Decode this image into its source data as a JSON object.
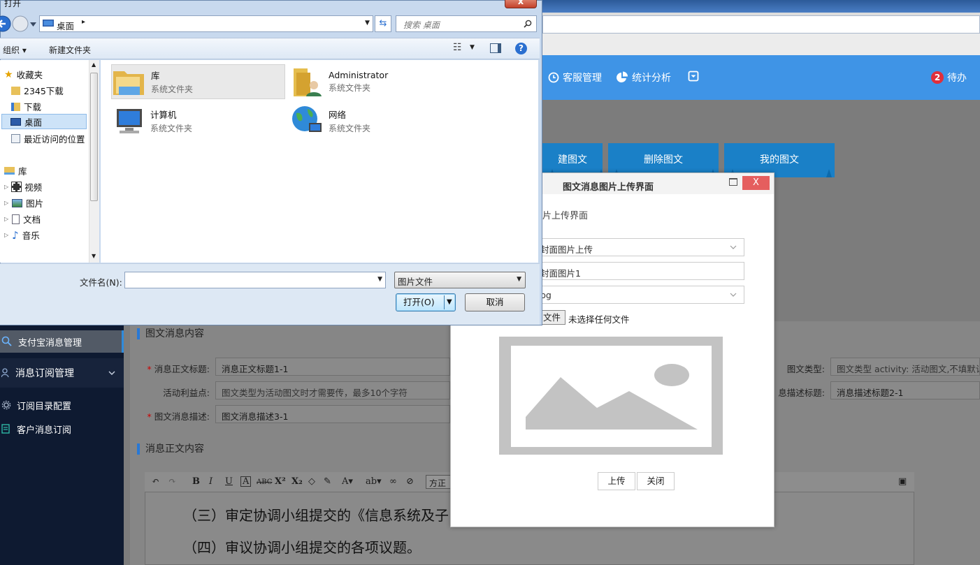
{
  "web": {
    "nav": {
      "service": "客服管理",
      "stats": "统计分析",
      "todo_count": "2",
      "todo_label": "待办"
    },
    "tabs": {
      "create": "建图文",
      "delete": "删除图文",
      "mine": "我的图文"
    },
    "sidebar": {
      "alipay": "支付宝消息管理",
      "subscription": "消息订阅管理",
      "catalog": "订阅目录配置",
      "customer": "客户消息订阅"
    },
    "sections": {
      "content": "图文消息内容",
      "body": "消息正文内容"
    },
    "form": {
      "body_title_label": "消息正文标题:",
      "body_title_value": "消息正文标题1-1",
      "benefit_label": "活动利益点:",
      "benefit_placeholder": "图文类型为活动图文时才需要传，最多10个字符",
      "desc_label": "图文消息描述:",
      "desc_value": "图文消息描述3-1",
      "type_label": "图文类型:",
      "type_placeholder": "图文类型 activity: 活动图文,不填默认普",
      "msg_desc_title_label": "息描述标题:",
      "msg_desc_title_value": "消息描述标题2-1"
    },
    "editor": {
      "font_value": "方正",
      "lines": [
        "（三）审定协调小组提交的《信息系统及子",
        "（四）审议协调小组提交的各项议题。"
      ]
    }
  },
  "modal": {
    "title": "图文消息图片上传界面",
    "subtitle": "片上传界面",
    "upload_type": "封面图片上传",
    "image_name": "封面图片1",
    "format": "pg",
    "choose_file_tail": "文件",
    "no_file": "未选择任何文件",
    "upload_btn": "上传",
    "close_btn": "关闭",
    "close_x": "X"
  },
  "dialog": {
    "title": "打开",
    "close": "x",
    "address": "桌面",
    "search_placeholder": "搜索 桌面",
    "organize": "组织",
    "new_folder": "新建文件夹",
    "nav": {
      "favorites": "收藏夹",
      "downloads2345": "2345下载",
      "downloads": "下载",
      "desktop": "桌面",
      "recent": "最近访问的位置",
      "libraries": "库",
      "videos": "视频",
      "pictures": "图片",
      "documents": "文档",
      "music": "音乐"
    },
    "files": [
      {
        "name": "库",
        "type": "系统文件夹"
      },
      {
        "name": "Administrator",
        "type": "系统文件夹"
      },
      {
        "name": "计算机",
        "type": "系统文件夹"
      },
      {
        "name": "网络",
        "type": "系统文件夹"
      }
    ],
    "filename_label": "文件名(N):",
    "filename_value": "",
    "filetype": "图片文件",
    "open_btn": "打开(O)",
    "cancel_btn": "取消"
  }
}
